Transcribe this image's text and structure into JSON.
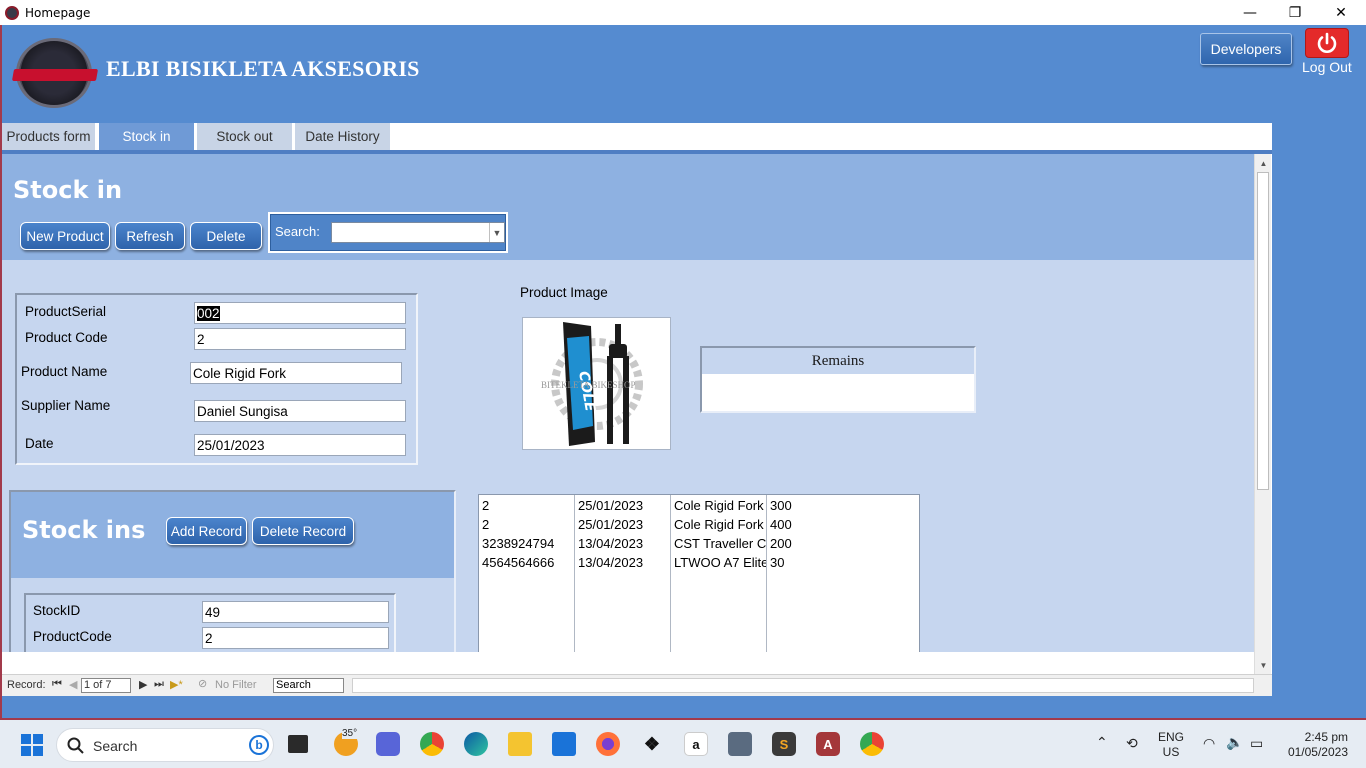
{
  "window": {
    "title": "Homepage",
    "minimize": "—",
    "restore": "❐",
    "close": "✕"
  },
  "header": {
    "brand": "ELBI BISIKLETA AKSESORIS",
    "developers_label": "Developers",
    "logout_label": "Log Out"
  },
  "tabs": [
    {
      "label": "Products form",
      "active": false
    },
    {
      "label": "Stock in",
      "active": true
    },
    {
      "label": "Stock out",
      "active": false
    },
    {
      "label": "Date History",
      "active": false
    }
  ],
  "form": {
    "title": "Stock in",
    "buttons": {
      "new_product": "New Product",
      "refresh": "Refresh",
      "delete": "Delete"
    },
    "search_label": "Search:",
    "search_value": "",
    "fields": {
      "product_serial": {
        "label": "ProductSerial",
        "value": "002"
      },
      "product_code": {
        "label": "Product Code",
        "value": "2"
      },
      "product_name": {
        "label": "Product Name",
        "value": "Cole Rigid Fork"
      },
      "supplier_name": {
        "label": "Supplier Name",
        "value": "Daniel Sungisa"
      },
      "date": {
        "label": "Date",
        "value": "25/01/2023"
      }
    },
    "image_label": "Product Image",
    "image_caption": "COLE",
    "image_watermark": "BITEKLETA BIKESHOP",
    "remains_header": "Remains",
    "remains_value": ""
  },
  "subform": {
    "title": "Stock ins",
    "add_record": "Add Record",
    "delete_record": "Delete Record",
    "fields": {
      "stock_id": {
        "label": "StockID",
        "value": "49"
      },
      "product_code": {
        "label": "ProductCode",
        "value": "2"
      }
    }
  },
  "list_rows": [
    {
      "code": "2",
      "date": "25/01/2023",
      "name": "Cole Rigid Fork",
      "qty": "300"
    },
    {
      "code": "2",
      "date": "25/01/2023",
      "name": "Cole Rigid Fork",
      "qty": "400"
    },
    {
      "code": "3238924794",
      "date": "13/04/2023",
      "name": "CST Traveller C",
      "qty": "200"
    },
    {
      "code": "4564564666",
      "date": "13/04/2023",
      "name": "LTWOO A7 Elite",
      "qty": "30"
    }
  ],
  "navbar": {
    "record_label": "Record:",
    "record_value": "1 of 7",
    "no_filter": "No Filter",
    "search_value": "Search"
  },
  "taskbar": {
    "search_placeholder": "Search",
    "weather_badge": "35°",
    "lang_top": "ENG",
    "lang_bottom": "US",
    "time": "2:45 pm",
    "date": "01/05/2023"
  },
  "colors": {
    "accent": "#558bd0",
    "header_band": "#8eb1e1",
    "form_bg": "#c6d6ef",
    "logout_red": "#e42a2a"
  }
}
